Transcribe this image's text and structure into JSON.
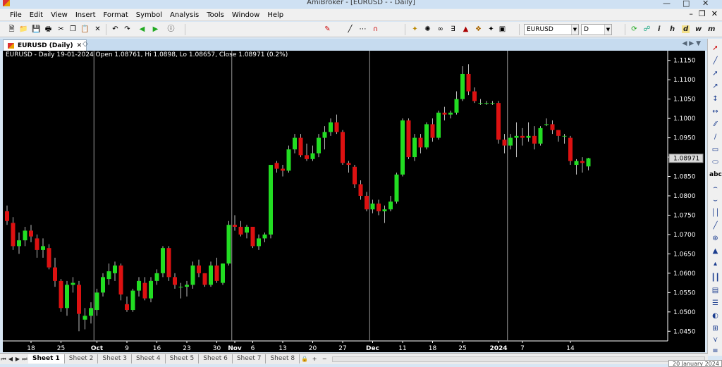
{
  "window": {
    "title": "AmiBroker - [EURUSD -  - Daily]"
  },
  "menu": [
    "File",
    "Edit",
    "View",
    "Insert",
    "Format",
    "Symbol",
    "Analysis",
    "Tools",
    "Window",
    "Help"
  ],
  "toolbar": {
    "symbol": "EURUSD",
    "interval": "D",
    "timeframes": [
      "i",
      "h",
      "d",
      "w",
      "m"
    ]
  },
  "chart_tab": {
    "label": "EURUSD (Daily)"
  },
  "chart": {
    "legend": "EURUSD - Daily 19-01-2024 Open 1.08761, Hi 1.0898, Lo 1.08657, Close 1.08971 (0.2%)",
    "last_price_label": "1.08971"
  },
  "sheets": [
    "Sheet 1",
    "Sheet 2",
    "Sheet 3",
    "Sheet 4",
    "Sheet 5",
    "Sheet 6",
    "Sheet 7",
    "Sheet 8"
  ],
  "tooltip": "20 January 2024",
  "colors": {
    "up": "#22dd22",
    "down": "#dd1111",
    "background": "#000000"
  },
  "chart_data": {
    "type": "candlestick",
    "title": "EURUSD - Daily 19-01-2024 Open 1.08761, Hi 1.0898, Lo 1.08657, Close 1.08971 (0.2%)",
    "ylim": [
      1.0425,
      1.1175
    ],
    "yticks": [
      "1.1150",
      "1.1100",
      "1.1050",
      "1.1000",
      "1.0950",
      "1.0900",
      "1.0850",
      "1.0800",
      "1.0750",
      "1.0700",
      "1.0650",
      "1.0600",
      "1.0550",
      "1.0500",
      "1.0450"
    ],
    "xticks": [
      {
        "label": "18",
        "i": 4
      },
      {
        "label": "25",
        "i": 9
      },
      {
        "label": "Oct",
        "i": 15,
        "bold": true
      },
      {
        "label": "9",
        "i": 20
      },
      {
        "label": "16",
        "i": 25
      },
      {
        "label": "23",
        "i": 30
      },
      {
        "label": "30",
        "i": 35
      },
      {
        "label": "Nov",
        "i": 38,
        "bold": true
      },
      {
        "label": "6",
        "i": 41
      },
      {
        "label": "13",
        "i": 46
      },
      {
        "label": "20",
        "i": 51
      },
      {
        "label": "27",
        "i": 56
      },
      {
        "label": "Dec",
        "i": 61,
        "bold": true
      },
      {
        "label": "11",
        "i": 66
      },
      {
        "label": "18",
        "i": 71
      },
      {
        "label": "25",
        "i": 76
      },
      {
        "label": "2024",
        "i": 82,
        "bold": true
      },
      {
        "label": "7",
        "i": 86
      },
      {
        "label": "14",
        "i": 94
      }
    ],
    "vlines": [
      14.5,
      37.5,
      60.5,
      83.5
    ],
    "candles": [
      [
        1.076,
        1.0775,
        1.0725,
        1.0735
      ],
      [
        1.073,
        1.0745,
        1.066,
        1.067
      ],
      [
        1.067,
        1.0705,
        1.065,
        1.0685
      ],
      [
        1.0685,
        1.072,
        1.067,
        1.071
      ],
      [
        1.071,
        1.0725,
        1.068,
        1.0695
      ],
      [
        1.069,
        1.07,
        1.064,
        1.066
      ],
      [
        1.066,
        1.069,
        1.064,
        1.067
      ],
      [
        1.0665,
        1.0675,
        1.061,
        1.0615
      ],
      [
        1.0615,
        1.064,
        1.0565,
        1.058
      ],
      [
        1.058,
        1.0585,
        1.05,
        1.051
      ],
      [
        1.051,
        1.058,
        1.049,
        1.057
      ],
      [
        1.057,
        1.059,
        1.055,
        1.0575
      ],
      [
        1.057,
        1.058,
        1.045,
        1.0495
      ],
      [
        1.048,
        1.051,
        1.0455,
        1.049
      ],
      [
        1.049,
        1.0525,
        1.047,
        1.051
      ],
      [
        1.0505,
        1.056,
        1.049,
        1.055
      ],
      [
        1.055,
        1.06,
        1.054,
        1.059
      ],
      [
        1.0585,
        1.0625,
        1.057,
        1.0605
      ],
      [
        1.06,
        1.063,
        1.058,
        1.062
      ],
      [
        1.062,
        1.0625,
        1.053,
        1.0545
      ],
      [
        1.052,
        1.054,
        1.05,
        1.0505
      ],
      [
        1.0505,
        1.056,
        1.05,
        1.0555
      ],
      [
        1.0555,
        1.059,
        1.054,
        1.058
      ],
      [
        1.0575,
        1.059,
        1.053,
        1.0535
      ],
      [
        1.0535,
        1.059,
        1.0525,
        1.058
      ],
      [
        1.058,
        1.061,
        1.057,
        1.06
      ],
      [
        1.06,
        1.067,
        1.059,
        1.0665
      ],
      [
        1.0665,
        1.067,
        1.058,
        1.059
      ],
      [
        1.059,
        1.06,
        1.056,
        1.057
      ],
      [
        1.0565,
        1.0575,
        1.0535,
        1.0565
      ],
      [
        1.0565,
        1.058,
        1.054,
        1.057
      ],
      [
        1.057,
        1.063,
        1.056,
        1.062
      ],
      [
        1.062,
        1.0635,
        1.059,
        1.06
      ],
      [
        1.06,
        1.06,
        1.0565,
        1.057
      ],
      [
        1.057,
        1.063,
        1.0565,
        1.062
      ],
      [
        1.062,
        1.064,
        1.0575,
        1.058
      ],
      [
        1.0575,
        1.0625,
        1.057,
        1.0625
      ],
      [
        1.0625,
        1.0735,
        1.062,
        1.0725
      ],
      [
        1.0725,
        1.075,
        1.071,
        1.072
      ],
      [
        1.072,
        1.0735,
        1.0695,
        1.07
      ],
      [
        1.0705,
        1.0725,
        1.069,
        1.072
      ],
      [
        1.072,
        1.072,
        1.0665,
        1.067
      ],
      [
        1.067,
        1.07,
        1.066,
        1.069
      ],
      [
        1.069,
        1.0705,
        1.068,
        1.07
      ],
      [
        1.07,
        1.088,
        1.069,
        1.088
      ],
      [
        1.0885,
        1.089,
        1.086,
        1.087
      ],
      [
        1.087,
        1.088,
        1.085,
        1.0865
      ],
      [
        1.0865,
        1.093,
        1.086,
        1.092
      ],
      [
        1.092,
        1.096,
        1.091,
        1.095
      ],
      [
        1.095,
        1.096,
        1.09,
        1.0905
      ],
      [
        1.0905,
        1.0935,
        1.089,
        1.0895
      ],
      [
        1.0895,
        1.093,
        1.089,
        1.091
      ],
      [
        1.091,
        1.096,
        1.09,
        1.095
      ],
      [
        1.095,
        1.098,
        1.092,
        1.0965
      ],
      [
        1.0965,
        1.1,
        1.0955,
        1.099
      ],
      [
        1.099,
        1.101,
        1.096,
        1.0965
      ],
      [
        1.0965,
        1.097,
        1.088,
        1.0885
      ],
      [
        1.0885,
        1.089,
        1.086,
        1.088
      ],
      [
        1.0875,
        1.088,
        1.082,
        1.083
      ],
      [
        1.083,
        1.084,
        1.079,
        1.08
      ],
      [
        1.08,
        1.081,
        1.076,
        1.0765
      ],
      [
        1.0765,
        1.079,
        1.0755,
        1.078
      ],
      [
        1.078,
        1.079,
        1.075,
        1.076
      ],
      [
        1.076,
        1.0775,
        1.073,
        1.0765
      ],
      [
        1.0765,
        1.08,
        1.076,
        1.0785
      ],
      [
        1.0785,
        1.086,
        1.078,
        1.0855
      ],
      [
        1.0855,
        1.1,
        1.085,
        1.0995
      ],
      [
        1.0995,
        1.1,
        1.0895,
        1.09
      ],
      [
        1.09,
        1.096,
        1.089,
        1.095
      ],
      [
        1.095,
        1.096,
        1.091,
        1.0925
      ],
      [
        1.0925,
        1.099,
        1.092,
        1.0985
      ],
      [
        1.0985,
        1.1,
        1.094,
        1.095
      ],
      [
        1.095,
        1.102,
        1.0945,
        1.1015
      ],
      [
        1.1015,
        1.103,
        1.0995,
        1.101
      ],
      [
        1.101,
        1.102,
        1.1,
        1.1015
      ],
      [
        1.1015,
        1.107,
        1.101,
        1.105
      ],
      [
        1.105,
        1.1135,
        1.1045,
        1.1115
      ],
      [
        1.1115,
        1.114,
        1.106,
        1.107
      ],
      [
        1.107,
        1.108,
        1.104,
        1.1045
      ],
      [
        1.104,
        1.105,
        1.1035,
        1.104
      ],
      [
        1.104,
        1.1045,
        1.1035,
        1.104
      ],
      [
        1.104,
        1.1045,
        1.1035,
        1.104
      ],
      [
        1.104,
        1.1045,
        1.0935,
        1.0945
      ],
      [
        1.0945,
        1.096,
        1.091,
        1.093
      ],
      [
        1.093,
        1.096,
        1.092,
        1.095
      ],
      [
        1.095,
        1.099,
        1.09,
        1.0955
      ],
      [
        1.0955,
        1.0975,
        1.093,
        1.095
      ],
      [
        1.095,
        1.099,
        1.094,
        1.0955
      ],
      [
        1.0955,
        1.098,
        1.092,
        1.0935
      ],
      [
        1.0935,
        1.098,
        1.093,
        1.0975
      ],
      [
        1.0985,
        1.1,
        1.098,
        1.0985
      ],
      [
        1.0985,
        1.0995,
        1.096,
        1.097
      ],
      [
        1.097,
        1.097,
        1.094,
        1.0955
      ],
      [
        1.0955,
        1.096,
        1.0935,
        1.0955
      ],
      [
        1.095,
        1.0955,
        1.088,
        1.089
      ],
      [
        1.088,
        1.0895,
        1.0855,
        1.089
      ],
      [
        1.089,
        1.09,
        1.086,
        1.0885
      ],
      [
        1.0876,
        1.0898,
        1.0866,
        1.0897
      ]
    ]
  }
}
